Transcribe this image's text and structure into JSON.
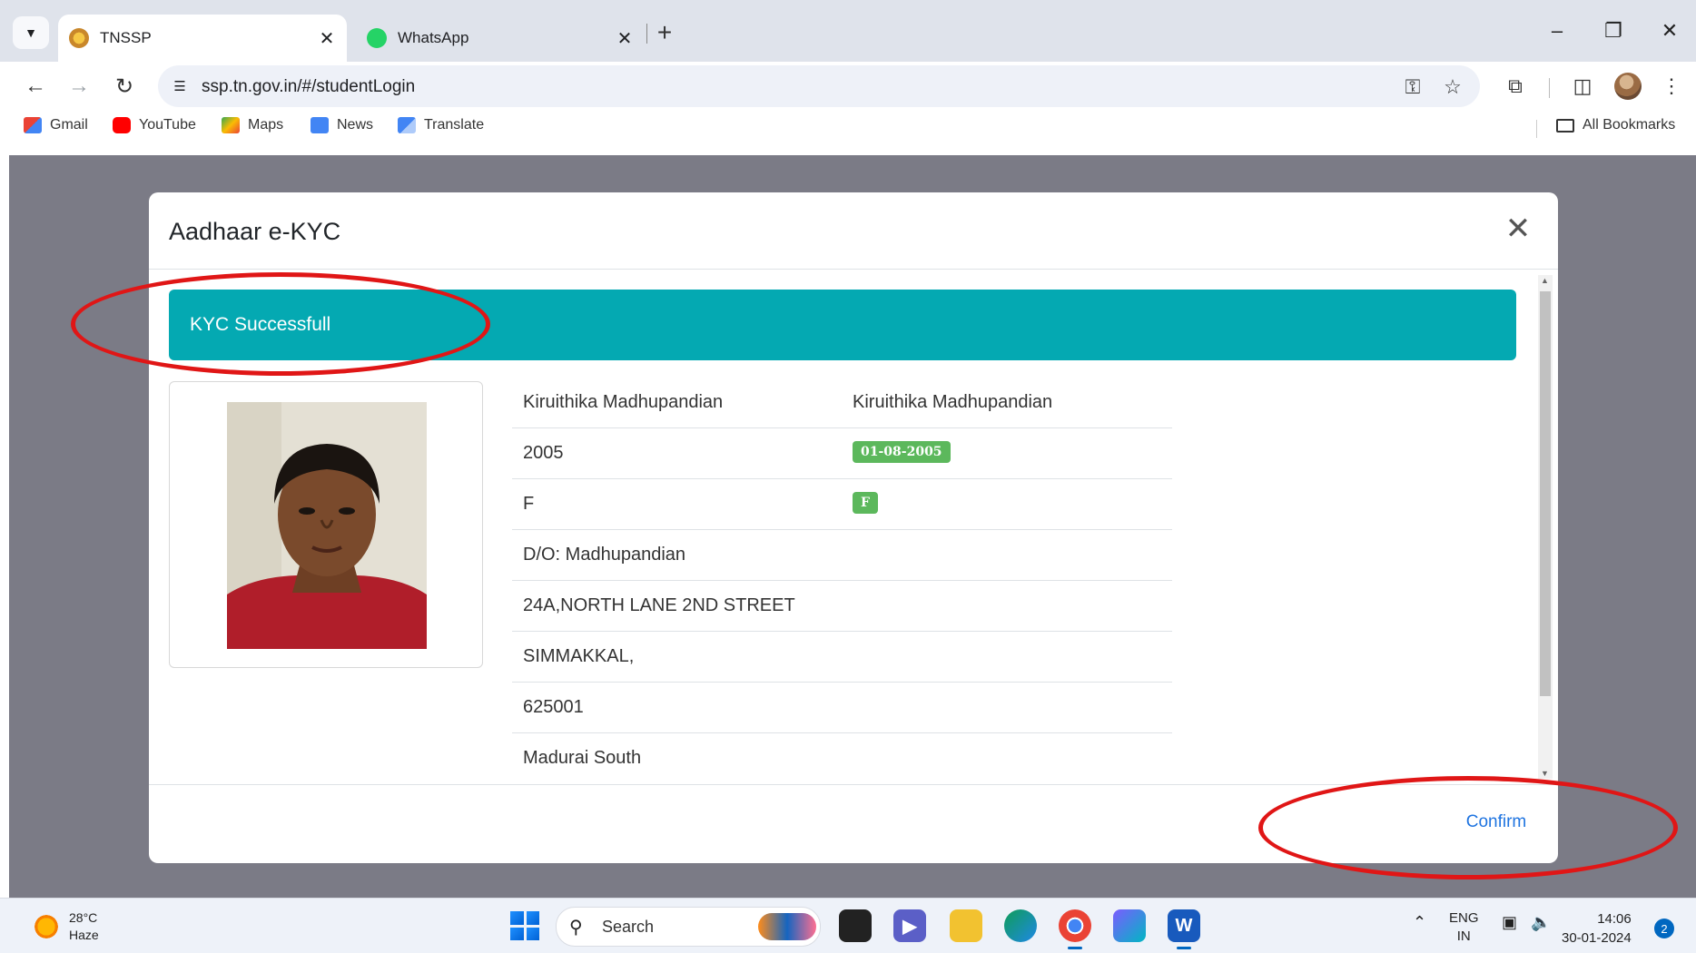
{
  "browser": {
    "tabs": [
      {
        "title": "TNSSP",
        "favicon": "tn-emblem-icon",
        "active": true
      },
      {
        "title": "WhatsApp",
        "favicon": "whatsapp-icon",
        "active": false
      }
    ],
    "new_tab_symbol": "+",
    "url": "ssp.tn.gov.in/#/studentLogin",
    "bookmarks": [
      {
        "label": "Gmail",
        "icon": "gmail-icon",
        "color": "#ea4335"
      },
      {
        "label": "YouTube",
        "icon": "youtube-icon",
        "color": "#ff0000"
      },
      {
        "label": "Maps",
        "icon": "maps-icon",
        "color": "#34a853"
      },
      {
        "label": "News",
        "icon": "news-icon",
        "color": "#4285f4"
      },
      {
        "label": "Translate",
        "icon": "translate-icon",
        "color": "#4285f4"
      }
    ],
    "all_bookmarks": "All Bookmarks"
  },
  "modal": {
    "title": "Aadhaar e-KYC",
    "alert": "KYC Successfull",
    "alert_color": "#04a9b2",
    "rows": [
      {
        "label": "Kiruithika Madhupandian",
        "value": "Kiruithika Madhupandian",
        "kind": "text"
      },
      {
        "label": "2005",
        "value": "01-08-2005",
        "kind": "badge"
      },
      {
        "label": "F",
        "value": "F",
        "kind": "badge"
      },
      {
        "label": "D/O: Madhupandian",
        "value": "",
        "kind": "none"
      },
      {
        "label": "24A,NORTH LANE 2ND STREET",
        "value": "",
        "kind": "none"
      },
      {
        "label": "SIMMAKKAL,",
        "value": "",
        "kind": "none"
      },
      {
        "label": "625001",
        "value": "",
        "kind": "none"
      },
      {
        "label": "Madurai South",
        "value": "",
        "kind": "none"
      }
    ],
    "confirm_label": "Confirm",
    "annotation_color": "#e01616"
  },
  "taskbar": {
    "weather_temp": "28°C",
    "weather_desc": "Haze",
    "search_label": "Search",
    "language_line1": "ENG",
    "language_line2": "IN",
    "time": "14:06",
    "date": "30-01-2024",
    "notification_count": "2"
  }
}
